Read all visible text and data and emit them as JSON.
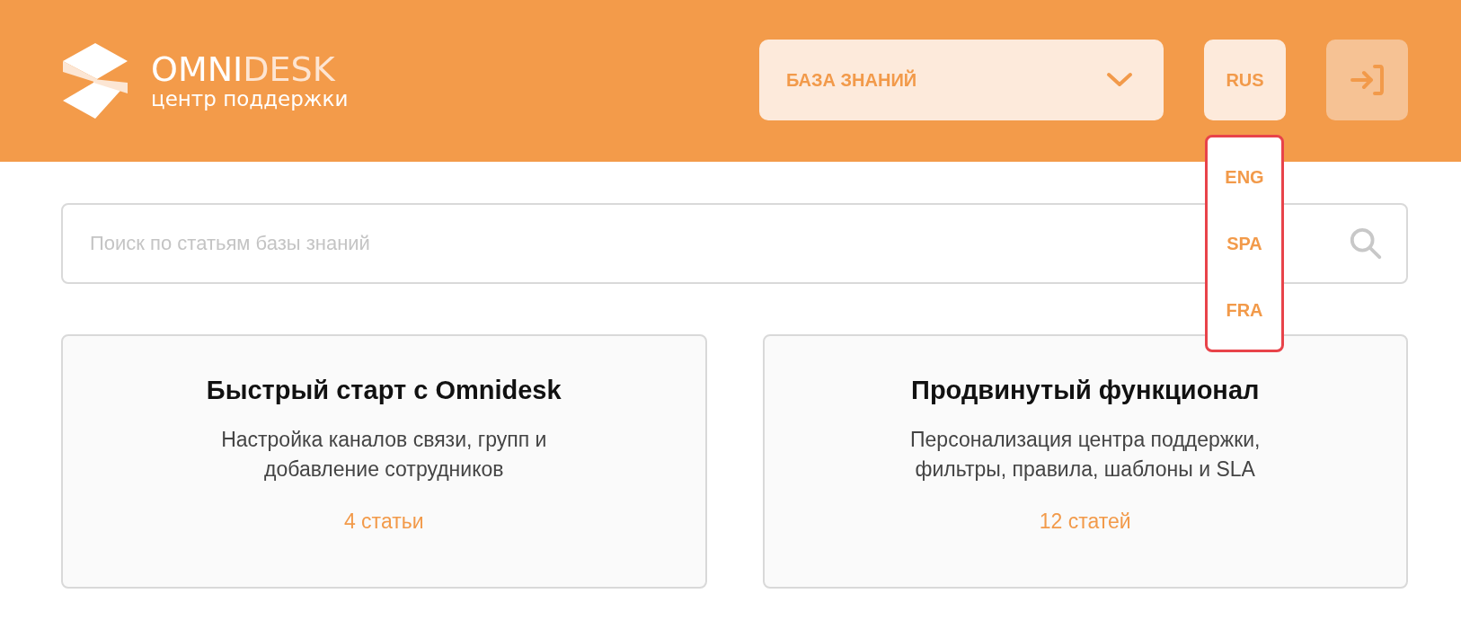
{
  "header": {
    "logo": {
      "brand_primary": "OMNI",
      "brand_secondary": "DESK",
      "subtitle": "центр поддержки"
    },
    "section_select": {
      "value": "БАЗА ЗНАНИЙ"
    },
    "language_select": {
      "value": "RUS",
      "expanded": true,
      "options": [
        {
          "label": "ENG"
        },
        {
          "label": "SPA"
        },
        {
          "label": "FRA"
        }
      ]
    }
  },
  "search": {
    "placeholder": "Поиск по статьям базы знаний"
  },
  "categories": [
    {
      "title": "Быстрый старт с Omnidesk",
      "description": "Настройка каналов связи, групп и добавление сотрудников",
      "count": "4 статьи"
    },
    {
      "title": "Продвинутый функционал",
      "description": "Персонализация центра поддержки, фильтры, правила, шаблоны и SLA",
      "count": "12 статей"
    }
  ]
}
